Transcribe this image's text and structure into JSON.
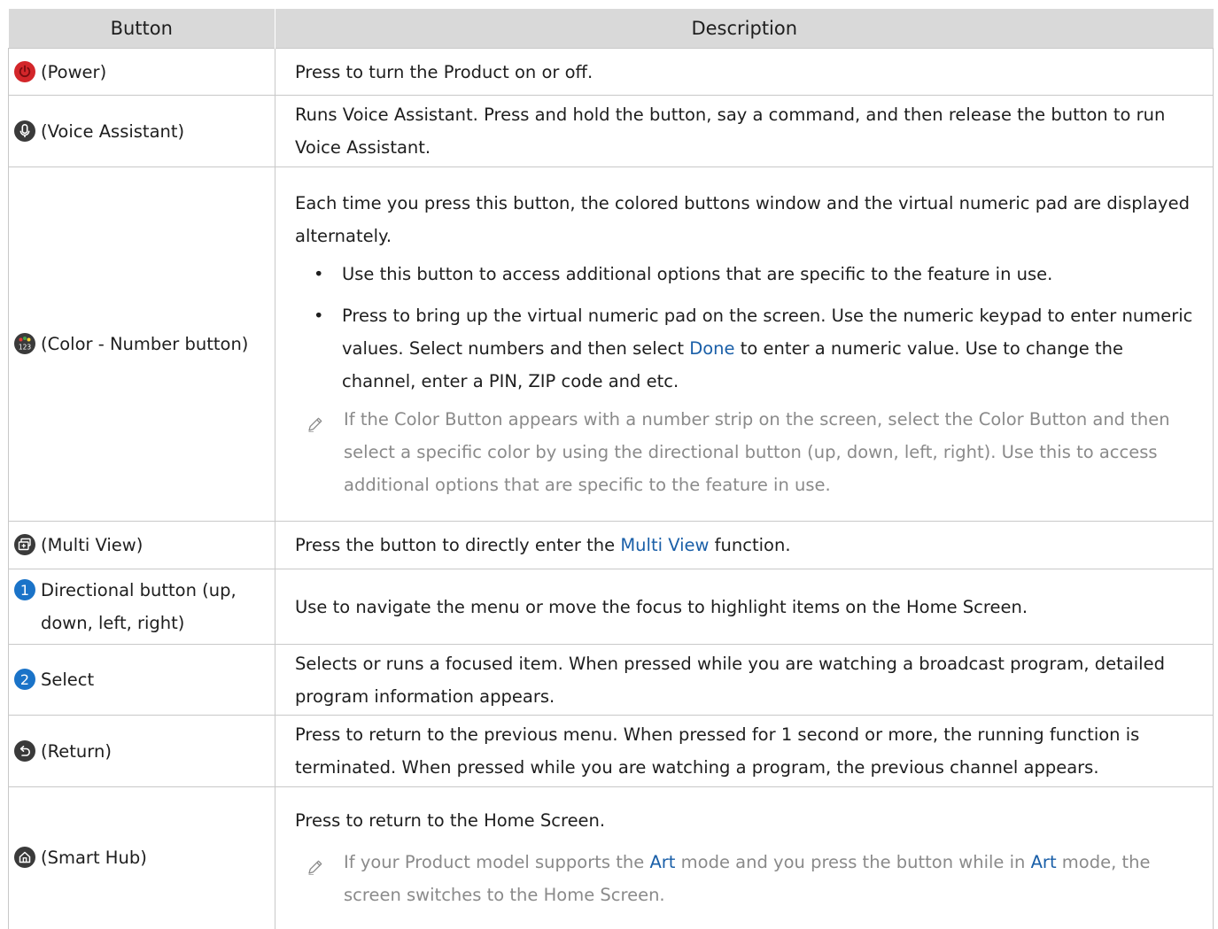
{
  "headers": {
    "button": "Button",
    "description": "Description"
  },
  "rows": [
    {
      "icon": "power-icon",
      "label": "(Power)",
      "desc": "Press to turn the Product on or off."
    },
    {
      "icon": "microphone-icon",
      "label": "(Voice Assistant)",
      "desc": "Runs Voice Assistant. Press and hold the button, say a command, and then release the button to run Voice Assistant."
    },
    {
      "icon": "color-number-icon",
      "icon_text": "123",
      "label": "(Color - Number button)",
      "desc": "Each time you press this button, the colored buttons window and the virtual numeric pad are displayed alternately.",
      "bullet1": "Use this button to access additional options that are specific to the feature in use.",
      "bullet2_a": "Press to bring up the virtual numeric pad on the screen. Use the numeric keypad to enter numeric values. Select numbers and then select ",
      "bullet2_link": "Done",
      "bullet2_b": " to enter a numeric value. Use to change the channel, enter a PIN, ZIP code and etc.",
      "note": "If the Color Button appears with a number strip on the screen, select the Color Button and then select a specific color by using the directional button (up, down, left, right). Use this to access additional options that are specific to the feature in use."
    },
    {
      "icon": "multi-view-icon",
      "label": "(Multi View)",
      "desc_a": "Press the button to directly enter the ",
      "desc_link": "Multi View",
      "desc_b": " function."
    },
    {
      "icon": "number-1-icon",
      "icon_text": "1",
      "label": "Directional button (up, down, left, right)",
      "desc": "Use to navigate the menu or move the focus to highlight items on the Home Screen."
    },
    {
      "icon": "number-2-icon",
      "icon_text": "2",
      "label": "Select",
      "desc": "Selects or runs a focused item. When pressed while you are watching a broadcast program, detailed program information appears."
    },
    {
      "icon": "return-icon",
      "label": "(Return)",
      "desc": "Press to return to the previous menu. When pressed for 1 second or more, the running function is terminated. When pressed while you are watching a program, the previous channel appears."
    },
    {
      "icon": "home-icon",
      "label": "(Smart Hub)",
      "desc": "Press to return to the Home Screen.",
      "note_a": "If your Product model supports the ",
      "note_link1": "Art",
      "note_b": " mode and you press the button while in ",
      "note_link2": "Art",
      "note_c": " mode, the screen switches to the Home Screen."
    }
  ],
  "colors": {
    "link": "#1a5fa8",
    "power": "#d3262a",
    "number_badge": "#1a73c8",
    "icon_dark": "#3a3a3a",
    "note_text": "#8a8a8a",
    "header_bg": "#d9d9d9"
  }
}
